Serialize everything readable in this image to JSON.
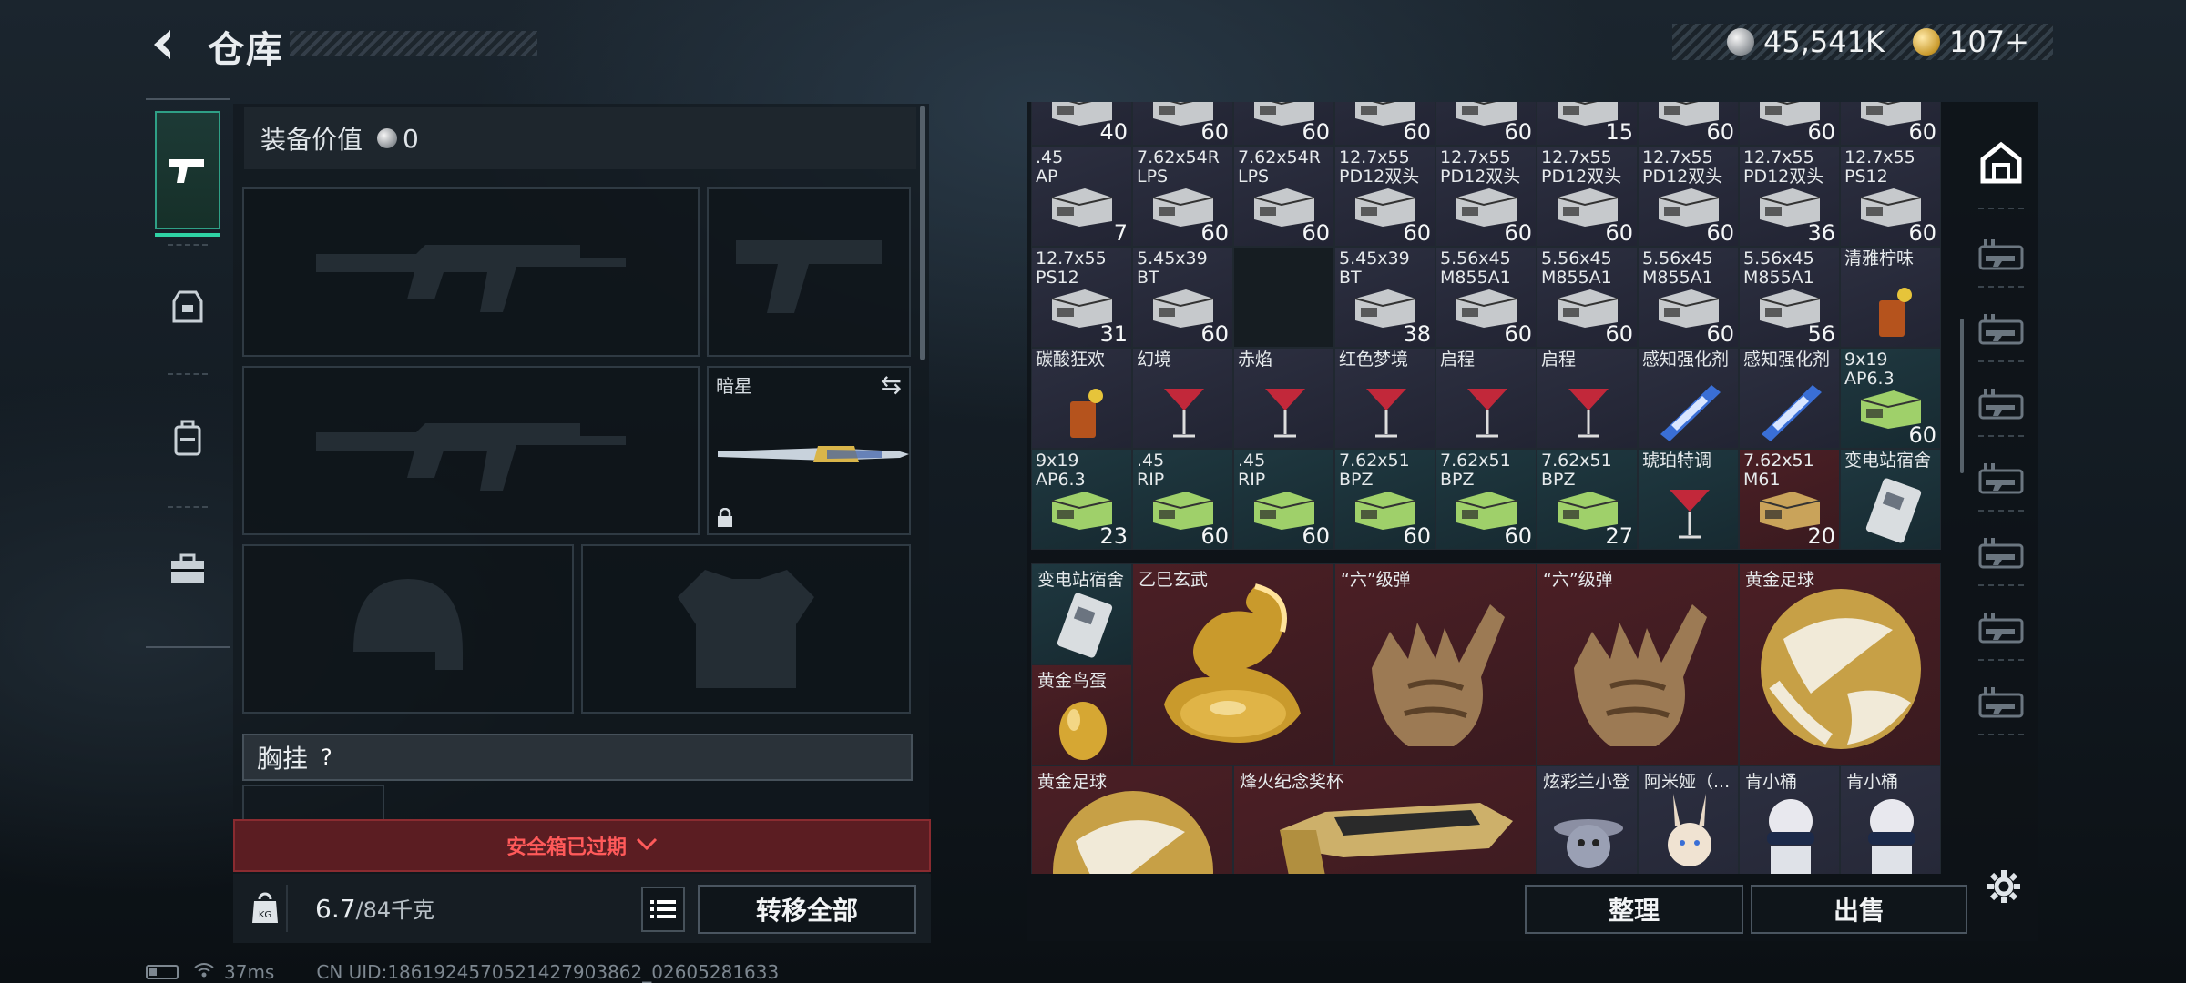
{
  "header": {
    "title": "仓库",
    "currency_silver": "45,541K",
    "currency_gold": "107+",
    "silver_icon": "silver-coin-icon",
    "gold_icon": "gold-coin-icon"
  },
  "side_tabs": [
    {
      "name": "weapons",
      "icon": "pistol-icon",
      "active": true
    },
    {
      "name": "helmet",
      "icon": "armor-icon",
      "active": false
    },
    {
      "name": "backpack",
      "icon": "backpack-icon",
      "active": false
    },
    {
      "name": "toolbox",
      "icon": "toolbox-icon",
      "active": false
    }
  ],
  "loadout": {
    "equip_value_label": "装备价值",
    "equip_value": "0",
    "melee_label": "暗星",
    "chest_label": "胸挂",
    "chest_help": "?",
    "safe_box_expired": "安全箱已过期",
    "weight_current": "6.7",
    "weight_max": "/84千克",
    "transfer_all": "转移全部"
  },
  "stash": {
    "rows": [
      [
        {
          "n": "",
          "c": "40",
          "t": "purple",
          "k": "ammo"
        },
        {
          "n": "",
          "c": "60",
          "t": "purple",
          "k": "ammo"
        },
        {
          "n": "",
          "c": "60",
          "t": "purple",
          "k": "ammo"
        },
        {
          "n": "",
          "c": "60",
          "t": "purple",
          "k": "ammo"
        },
        {
          "n": "",
          "c": "60",
          "t": "purple",
          "k": "ammo"
        },
        {
          "n": "",
          "c": "15",
          "t": "purple",
          "k": "ammo"
        },
        {
          "n": "",
          "c": "60",
          "t": "purple",
          "k": "ammo"
        },
        {
          "n": "",
          "c": "60",
          "t": "purple",
          "k": "ammo"
        },
        {
          "n": "",
          "c": "60",
          "t": "purple",
          "k": "ammo"
        }
      ],
      [
        {
          "n": ".45\nAP",
          "c": "7",
          "t": "purple",
          "k": "ammo"
        },
        {
          "n": "7.62x54R\nLPS",
          "c": "60",
          "t": "purple",
          "k": "ammo"
        },
        {
          "n": "7.62x54R\nLPS",
          "c": "60",
          "t": "purple",
          "k": "ammo"
        },
        {
          "n": "12.7x55\nPD12双头",
          "c": "60",
          "t": "purple",
          "k": "ammo"
        },
        {
          "n": "12.7x55\nPD12双头",
          "c": "60",
          "t": "purple",
          "k": "ammo"
        },
        {
          "n": "12.7x55\nPD12双头",
          "c": "60",
          "t": "purple",
          "k": "ammo"
        },
        {
          "n": "12.7x55\nPD12双头",
          "c": "60",
          "t": "purple",
          "k": "ammo"
        },
        {
          "n": "12.7x55\nPD12双头",
          "c": "36",
          "t": "purple",
          "k": "ammo"
        },
        {
          "n": "12.7x55\nPS12",
          "c": "60",
          "t": "purple",
          "k": "ammo"
        }
      ],
      [
        {
          "n": "12.7x55\nPS12",
          "c": "31",
          "t": "purple",
          "k": "ammo"
        },
        {
          "n": "5.45x39\nBT",
          "c": "60",
          "t": "purple",
          "k": "ammo"
        },
        {
          "n": "",
          "c": "",
          "t": "dark",
          "k": "none"
        },
        {
          "n": "5.45x39\nBT",
          "c": "38",
          "t": "purple",
          "k": "ammo"
        },
        {
          "n": "5.56x45\nM855A1",
          "c": "60",
          "t": "purple",
          "k": "ammo"
        },
        {
          "n": "5.56x45\nM855A1",
          "c": "60",
          "t": "purple",
          "k": "ammo"
        },
        {
          "n": "5.56x45\nM855A1",
          "c": "60",
          "t": "purple",
          "k": "ammo"
        },
        {
          "n": "5.56x45\nM855A1",
          "c": "56",
          "t": "purple",
          "k": "ammo"
        },
        {
          "n": "清雅柠味",
          "c": "",
          "t": "purple",
          "k": "drink"
        }
      ],
      [
        {
          "n": "碳酸狂欢",
          "c": "",
          "t": "purple",
          "k": "drink"
        },
        {
          "n": "幻境",
          "c": "",
          "t": "purple",
          "k": "cocktail"
        },
        {
          "n": "赤焰",
          "c": "",
          "t": "purple",
          "k": "cocktail"
        },
        {
          "n": "红色梦境",
          "c": "",
          "t": "purple",
          "k": "cocktail"
        },
        {
          "n": "启程",
          "c": "",
          "t": "purple",
          "k": "cocktail"
        },
        {
          "n": "启程",
          "c": "",
          "t": "purple",
          "k": "cocktail"
        },
        {
          "n": "感知强化剂",
          "c": "",
          "t": "purple",
          "k": "syringe"
        },
        {
          "n": "感知强化剂",
          "c": "",
          "t": "purple",
          "k": "syringe"
        },
        {
          "n": "9x19\nAP6.3",
          "c": "60",
          "t": "teal",
          "k": "ammo"
        }
      ],
      [
        {
          "n": "9x19\nAP6.3",
          "c": "23",
          "t": "teal",
          "k": "ammo"
        },
        {
          "n": ".45\nRIP",
          "c": "60",
          "t": "teal",
          "k": "ammo"
        },
        {
          "n": ".45\nRIP",
          "c": "60",
          "t": "teal",
          "k": "ammo"
        },
        {
          "n": "7.62x51\nBPZ",
          "c": "60",
          "t": "teal",
          "k": "ammo"
        },
        {
          "n": "7.62x51\nBPZ",
          "c": "60",
          "t": "teal",
          "k": "ammo"
        },
        {
          "n": "7.62x51\nBPZ",
          "c": "27",
          "t": "teal",
          "k": "ammo"
        },
        {
          "n": "琥珀特调",
          "c": "",
          "t": "teal",
          "k": "cocktail"
        },
        {
          "n": "7.62x51\nM61",
          "c": "20",
          "t": "red",
          "k": "ammo"
        },
        {
          "n": "变电站宿舍",
          "c": "",
          "t": "teal",
          "k": "keycard"
        }
      ]
    ],
    "large_items": [
      {
        "n": "变电站宿舍",
        "kind": "keycard-small"
      },
      {
        "n": "乙巳玄武",
        "kind": "golden-dragon"
      },
      {
        "n": "“六”级弹",
        "kind": "golden-hand"
      },
      {
        "n": "“六”级弹",
        "kind": "golden-hand"
      },
      {
        "n": "黄金足球",
        "kind": "gold-ball"
      },
      {
        "n": "黄金鸟蛋",
        "kind": "gold-egg"
      },
      {
        "n": "黄金足球",
        "kind": "gold-ball"
      },
      {
        "n": "烽火纪念奖杯",
        "kind": "trophy"
      },
      {
        "n": "炫彩兰小登",
        "kind": "figure"
      },
      {
        "n": "阿米娅（...",
        "kind": "figure"
      },
      {
        "n": "肯小桶",
        "kind": "figure"
      },
      {
        "n": "肯小桶",
        "kind": "figure"
      }
    ],
    "sort_label": "整理",
    "sell_label": "出售"
  },
  "right_tabs": [
    "home-icon",
    "weapon-case-icon",
    "weapon-case-icon",
    "weapon-case-icon",
    "weapon-case-icon",
    "weapon-case-icon",
    "weapon-case-icon",
    "weapon-case-icon"
  ],
  "status_bar": {
    "ping": "37ms",
    "uid": "CN UID:1861924570521427903862_02605281633"
  },
  "colors": {
    "accent": "#2fd3a5",
    "expired": "#ff5a5a",
    "rarity_purple": "#2c2f40",
    "rarity_teal": "#1f3840",
    "rarity_red": "#4b1f25"
  }
}
